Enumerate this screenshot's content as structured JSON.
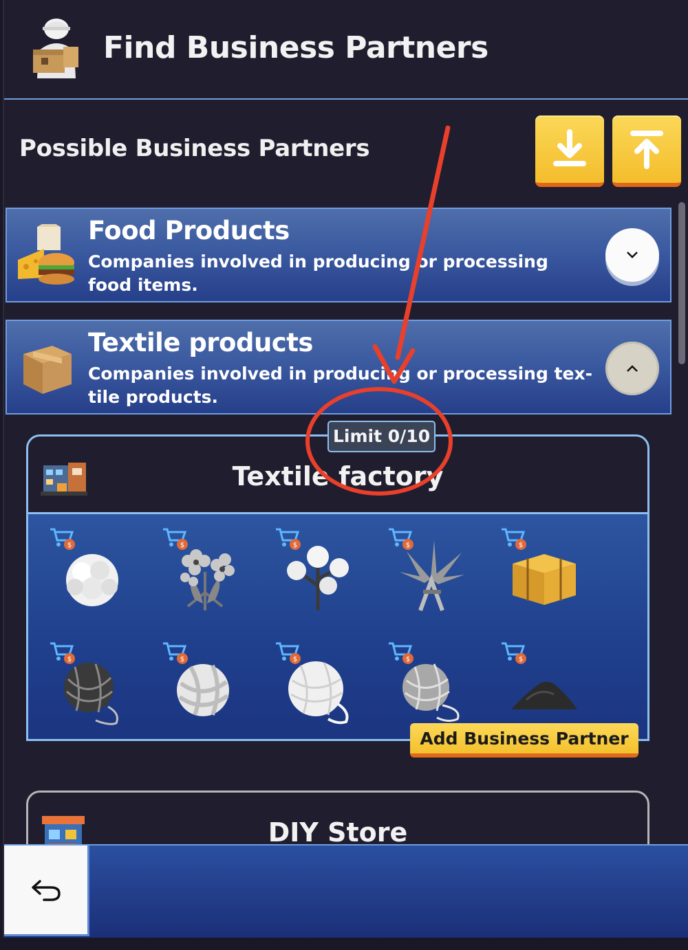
{
  "header": {
    "title": "Find Business Partners",
    "icon": "courier-icon"
  },
  "section": {
    "title": "Possible Business Partners",
    "buttons": [
      {
        "name": "import-button",
        "icon": "download-icon"
      },
      {
        "name": "export-button",
        "icon": "upload-icon"
      }
    ]
  },
  "categories": [
    {
      "title": "Food Products",
      "description": "Companies involved in producing or processing food items.",
      "icon": "food-icon",
      "expanded": false,
      "toggle_glyph": "⌄"
    },
    {
      "title": "Textile products",
      "description": "Companies involved in producing or processing tex-tile products.",
      "icon": "box-icon",
      "expanded": true,
      "toggle_glyph": "⌃"
    }
  ],
  "companies": [
    {
      "title": "Textile factory",
      "limit": "Limit 0/10",
      "products": [
        "wool",
        "flax-flower",
        "cotton",
        "hemp",
        "hay-bale",
        "black-yarn",
        "white-wool-ball",
        "white-yarn",
        "grey-yarn",
        "black-powder"
      ],
      "action_label": "Add Business Partner"
    },
    {
      "title": "DIY Store"
    }
  ],
  "colors": {
    "accent_yellow": "#f4bd2c",
    "border_blue": "#8dc0f2",
    "annotation_red": "#e8402b"
  }
}
